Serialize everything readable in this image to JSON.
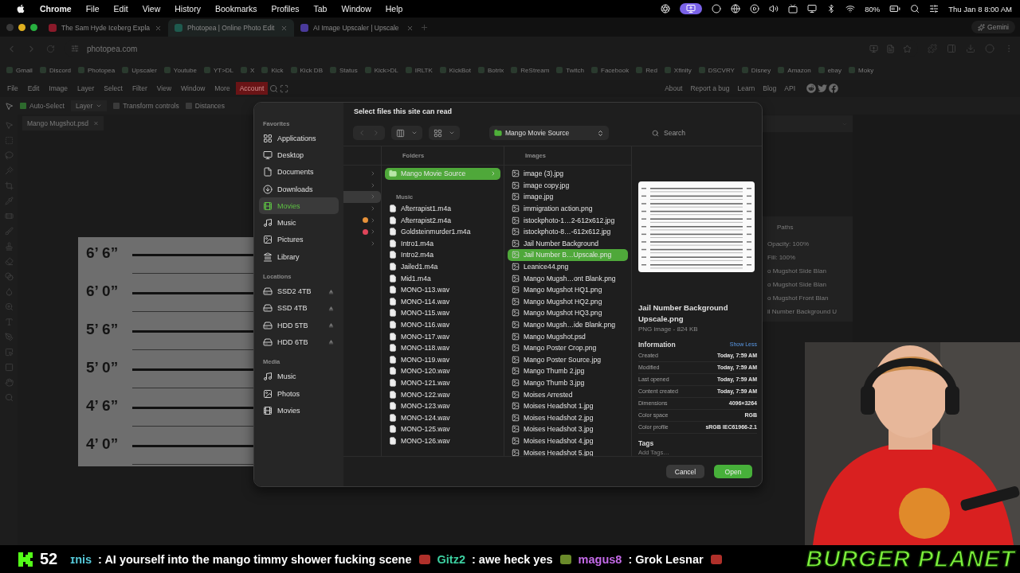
{
  "menu_bar": {
    "app": "Chrome",
    "items": [
      "File",
      "Edit",
      "View",
      "History",
      "Bookmarks",
      "Profiles",
      "Tab",
      "Window",
      "Help"
    ],
    "battery": "80%",
    "clock": "Thu Jan 8  8:00 AM"
  },
  "browser": {
    "tabs": [
      {
        "title": "The Sam Hyde Iceberg Expla",
        "selected": false
      },
      {
        "title": "Photopea | Online Photo Edit",
        "selected": true
      },
      {
        "title": "AI Image Upscaler | Upscale",
        "selected": false
      }
    ],
    "gemini": "Gemini",
    "address": "photopea.com",
    "bookmarks": [
      "Gmail",
      "Discord",
      "Photopea",
      "Upscaler",
      "Youtube",
      "YT>DL",
      "X",
      "Kick",
      "Kick DB",
      "Status",
      "Kick>DL",
      "IRLTK",
      "KickBot",
      "Botrix",
      "ReStream",
      "Twitch",
      "Facebook",
      "Red",
      "Xfinity",
      "DSCVRY",
      "Disney",
      "Amazon",
      "ebay",
      "Moky"
    ]
  },
  "photopea": {
    "menu": [
      {
        "label": "File",
        "selected": false
      },
      {
        "label": "Edit",
        "selected": false
      },
      {
        "label": "Image",
        "selected": false
      },
      {
        "label": "Layer",
        "selected": false
      },
      {
        "label": "Select",
        "selected": false
      },
      {
        "label": "Filter",
        "selected": false
      },
      {
        "label": "View",
        "selected": false
      },
      {
        "label": "Window",
        "selected": false
      },
      {
        "label": "More",
        "selected": false
      },
      {
        "label": "Account",
        "selected": true
      }
    ],
    "links": [
      "About",
      "Report a bug",
      "Learn",
      "Blog",
      "API"
    ],
    "options": [
      {
        "kind": "checkbox",
        "label": "Auto-Select",
        "checked": true
      },
      {
        "kind": "dropdown",
        "label": "Layer"
      },
      {
        "kind": "checkbox",
        "label": "Transform controls",
        "checked": false
      },
      {
        "kind": "checkbox",
        "label": "Distances",
        "checked": false
      }
    ],
    "document_tab": "Mango Mugshot.psd",
    "canvas_labels": [
      "6’ 6”",
      "6’ 0”",
      "5’ 6”",
      "5’ 0”",
      "4’ 6”",
      "4’ 0”"
    ],
    "layers_panel": {
      "tab": "Paths",
      "opacity": "Opacity: 100%",
      "fill": "Fill: 100%",
      "layers": [
        "o Mugshot Side Blan",
        "o Mugshot Side Blan",
        "o Mugshot Front Blan",
        "il Number Background U"
      ]
    }
  },
  "dialog": {
    "title": "Select files this site can read",
    "sidebar": [
      {
        "heading": "Favorites",
        "items": [
          {
            "label": "Applications",
            "selected": false
          },
          {
            "label": "Desktop",
            "selected": false
          },
          {
            "label": "Documents",
            "selected": false
          },
          {
            "label": "Downloads",
            "selected": false
          },
          {
            "label": "Movies",
            "selected": true
          },
          {
            "label": "Music",
            "selected": false
          },
          {
            "label": "Pictures",
            "selected": false
          },
          {
            "label": "Library",
            "selected": false
          }
        ]
      },
      {
        "heading": "Locations",
        "items": [
          {
            "label": "SSD2 4TB",
            "selected": false,
            "ejectable": true
          },
          {
            "label": "SSD 4TB",
            "selected": false,
            "ejectable": true
          },
          {
            "label": "HDD 5TB",
            "selected": false,
            "ejectable": true
          },
          {
            "label": "HDD 6TB",
            "selected": false,
            "ejectable": true
          }
        ]
      },
      {
        "heading": "Media",
        "items": [
          {
            "label": "Music",
            "selected": false
          },
          {
            "label": "Photos",
            "selected": false
          },
          {
            "label": "Movies",
            "selected": false
          }
        ]
      }
    ],
    "path": "Mango Movie Source",
    "search": {
      "placeholder": "Search"
    },
    "column_1": [
      {
        "selected": false
      },
      {
        "selected": false
      },
      {
        "selected": true
      },
      {
        "selected": false
      },
      {
        "selected": false,
        "color": "#e8923a"
      },
      {
        "selected": false,
        "color": "#e0455a"
      },
      {
        "selected": false
      }
    ],
    "folders": {
      "heading": "Folders",
      "items": [
        {
          "label": "Mango Movie Source",
          "selected": true
        }
      ]
    },
    "music": {
      "heading": "Music",
      "files": [
        "Afterrapist1.m4a",
        "Afterrapist2.m4a",
        "Goldsteinmurder1.m4a",
        "Intro1.m4a",
        "Intro2.m4a",
        "Jailed1.m4a",
        "Mid1.m4a",
        "MONO-113.wav",
        "MONO-114.wav",
        "MONO-115.wav",
        "MONO-116.wav",
        "MONO-117.wav",
        "MONO-118.wav",
        "MONO-119.wav",
        "MONO-120.wav",
        "MONO-121.wav",
        "MONO-122.wav",
        "MONO-123.wav",
        "MONO-124.wav",
        "MONO-125.wav",
        "MONO-126.wav"
      ]
    },
    "images": {
      "heading": "Images",
      "files": [
        {
          "label": "image (3).jpg",
          "selected": false
        },
        {
          "label": "image copy.jpg",
          "selected": false
        },
        {
          "label": "image.jpg",
          "selected": false
        },
        {
          "label": "immigration action.png",
          "selected": false
        },
        {
          "label": "istockphoto-1…2-612x612.jpg",
          "selected": false
        },
        {
          "label": "istockphoto-8…-612x612.jpg",
          "selected": false
        },
        {
          "label": "Jail Number Background",
          "selected": false
        },
        {
          "label": "Jail Number B…Upscale.png",
          "selected": true
        },
        {
          "label": "Leanice44.png",
          "selected": false
        },
        {
          "label": "Mango Mugsh…ont Blank.png",
          "selected": false
        },
        {
          "label": "Mango Mugshot HQ1.png",
          "selected": false
        },
        {
          "label": "Mango Mugshot HQ2.png",
          "selected": false
        },
        {
          "label": "Mango Mugshot HQ3.png",
          "selected": false
        },
        {
          "label": "Mango Mugsh…ide Blank.png",
          "selected": false
        },
        {
          "label": "Mango Mugshot.psd",
          "selected": false
        },
        {
          "label": "Mango Poster Crop.png",
          "selected": false
        },
        {
          "label": "Mango Poster Source.jpg",
          "selected": false
        },
        {
          "label": "Mango Thumb 2.jpg",
          "selected": false
        },
        {
          "label": "Mango Thumb 3.jpg",
          "selected": false
        },
        {
          "label": "Moises Arrested",
          "selected": false
        },
        {
          "label": "Moises Headshot 1.jpg",
          "selected": false
        },
        {
          "label": "Moises Headshot 2.jpg",
          "selected": false
        },
        {
          "label": "Moises Headshot 3.jpg",
          "selected": false
        },
        {
          "label": "Moises Headshot 4.jpg",
          "selected": false
        },
        {
          "label": "Moises Headshot 5.jpg",
          "selected": false
        }
      ]
    },
    "preview": {
      "name": "Jail Number Background Upscale.png",
      "kind_size": "PNG image - 824 KB",
      "info_heading": "Information",
      "toggle": "Show Less",
      "info": [
        {
          "label": "Created",
          "value": "Today, 7:59 AM"
        },
        {
          "label": "Modified",
          "value": "Today, 7:59 AM"
        },
        {
          "label": "Last opened",
          "value": "Today, 7:59 AM"
        },
        {
          "label": "Content created",
          "value": "Today, 7:59 AM"
        },
        {
          "label": "Dimensions",
          "value": "4096×3264"
        },
        {
          "label": "Color space",
          "value": "RGB"
        },
        {
          "label": "Color profile",
          "value": "sRGB IEC61966-2.1"
        }
      ],
      "tags_heading": "Tags",
      "tags_placeholder": "Add Tags…"
    },
    "buttons": [
      "Cancel",
      "Open"
    ]
  },
  "chat": {
    "viewers": "52",
    "messages": [
      {
        "user": "ɪnis",
        "color": "#55c8d8",
        "text": ": AI yourself into the mango timmy shower fucking scene"
      },
      {
        "user": "Gitz2",
        "color": "#3ccfa0",
        "text": ": awe heck yes"
      },
      {
        "user": "magus8",
        "color": "#c46ae8",
        "text": ": Grok Lesnar"
      }
    ],
    "banner": "BURGER PLANET"
  }
}
